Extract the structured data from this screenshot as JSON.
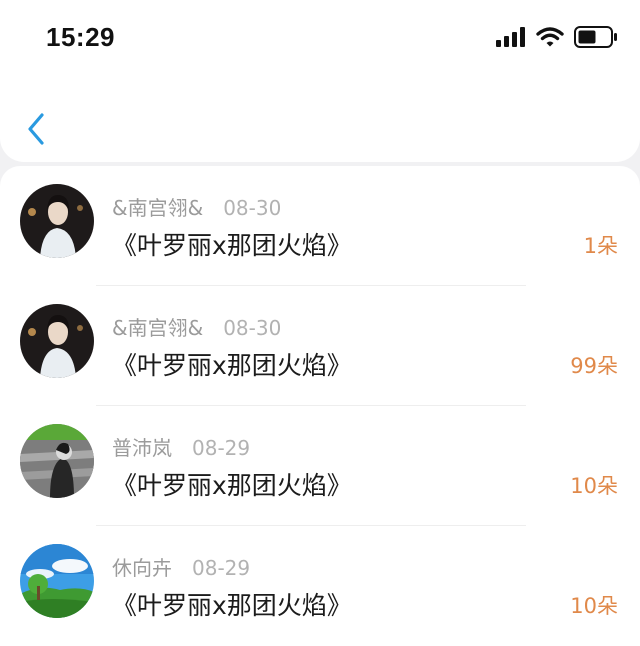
{
  "status_bar": {
    "time": "15:29",
    "icons": [
      "signal-icon",
      "wifi-icon",
      "battery-icon"
    ]
  },
  "nav": {
    "back_icon": "chevron-left-icon"
  },
  "colors": {
    "accent": "#2a9ae0",
    "amount": "#e0894a"
  },
  "records": [
    {
      "user": "&南宫翎&",
      "date": "08-30",
      "title": "《叶罗丽x那团火焰》",
      "amount": "1朵",
      "avatar": "woman-portrait"
    },
    {
      "user": "&南宫翎&",
      "date": "08-30",
      "title": "《叶罗丽x那团火焰》",
      "amount": "99朵",
      "avatar": "woman-portrait"
    },
    {
      "user": "普沛岚",
      "date": "08-29",
      "title": "《叶罗丽x那团火焰》",
      "amount": "10朵",
      "avatar": "bw-figure-green"
    },
    {
      "user": "休向卉",
      "date": "08-29",
      "title": "《叶罗丽x那团火焰》",
      "amount": "10朵",
      "avatar": "landscape-sky"
    }
  ]
}
